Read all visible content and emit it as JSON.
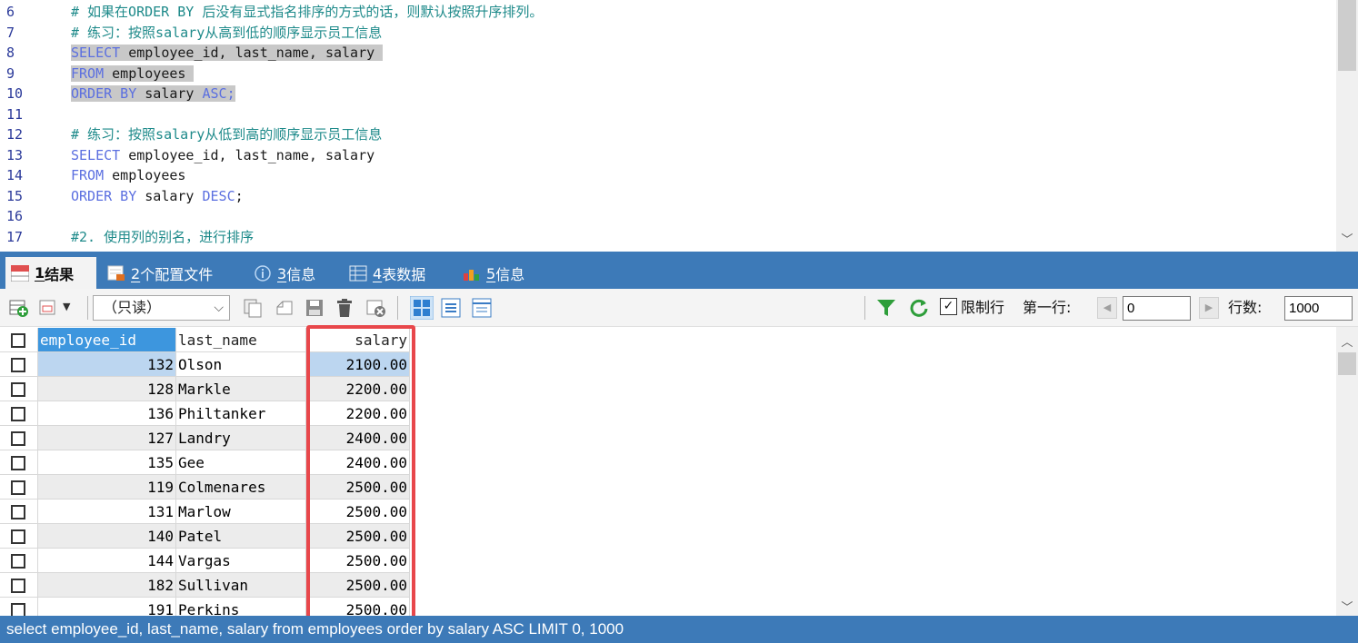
{
  "editor": {
    "lines": [
      {
        "num": "6",
        "parts": [
          {
            "t": "# 如果在ORDER BY 后没有显式指名排序的方式的话，则默认按照升序排列。",
            "c": "cm"
          }
        ],
        "hl": false
      },
      {
        "num": "7",
        "parts": [
          {
            "t": "# 练习：按照salary从高到低的顺序显示员工信息",
            "c": "cm"
          }
        ],
        "hl": false
      },
      {
        "num": "8",
        "parts": [
          {
            "t": "SELECT",
            "c": "kw"
          },
          {
            "t": " employee_id, last_name, salary ",
            "c": "id"
          }
        ],
        "hl": true
      },
      {
        "num": "9",
        "parts": [
          {
            "t": "FROM",
            "c": "kw"
          },
          {
            "t": " employees ",
            "c": "id"
          }
        ],
        "hl": true
      },
      {
        "num": "10",
        "parts": [
          {
            "t": "ORDER BY",
            "c": "kw"
          },
          {
            "t": " salary ",
            "c": "id"
          },
          {
            "t": "ASC;",
            "c": "kw"
          }
        ],
        "hl": true
      },
      {
        "num": "11",
        "parts": [],
        "hl": false
      },
      {
        "num": "12",
        "parts": [
          {
            "t": "# 练习：按照salary从低到高的顺序显示员工信息",
            "c": "cm"
          }
        ],
        "hl": false
      },
      {
        "num": "13",
        "parts": [
          {
            "t": "SELECT",
            "c": "kw"
          },
          {
            "t": " employee_id, last_name, salary",
            "c": "id"
          }
        ],
        "hl": false
      },
      {
        "num": "14",
        "parts": [
          {
            "t": "FROM",
            "c": "kw"
          },
          {
            "t": " employees",
            "c": "id"
          }
        ],
        "hl": false
      },
      {
        "num": "15",
        "parts": [
          {
            "t": "ORDER BY",
            "c": "kw"
          },
          {
            "t": " salary ",
            "c": "id"
          },
          {
            "t": "DESC",
            "c": "kw"
          },
          {
            "t": ";",
            "c": "id"
          }
        ],
        "hl": false
      },
      {
        "num": "16",
        "parts": [],
        "hl": false
      },
      {
        "num": "17",
        "parts": [
          {
            "t": "#2. 使用列的别名，进行排序",
            "c": "cm"
          }
        ],
        "hl": false
      }
    ]
  },
  "tabs": [
    {
      "num": "1",
      "label": " 结果",
      "icon": "result-grid-icon",
      "active": true
    },
    {
      "num": "2",
      "label": " 个配置文件",
      "icon": "profile-icon",
      "active": false
    },
    {
      "num": "3",
      "label": " 信息",
      "icon": "info-icon",
      "active": false
    },
    {
      "num": "4",
      "label": " 表数据",
      "icon": "table-data-icon",
      "active": false
    },
    {
      "num": "5",
      "label": " 信息",
      "icon": "info-chart-icon",
      "active": false
    }
  ],
  "toolbar": {
    "mode": "（只读）",
    "limit_rows_label": "限制行",
    "limit_rows_checked": true,
    "first_row_label": "第一行:",
    "first_row_value": "0",
    "row_count_label": "行数:",
    "row_count_value": "1000"
  },
  "grid": {
    "columns": [
      "employee_id",
      "last_name",
      "salary"
    ],
    "rows": [
      [
        "132",
        "Olson",
        "2100.00"
      ],
      [
        "128",
        "Markle",
        "2200.00"
      ],
      [
        "136",
        "Philtanker",
        "2200.00"
      ],
      [
        "127",
        "Landry",
        "2400.00"
      ],
      [
        "135",
        "Gee",
        "2400.00"
      ],
      [
        "119",
        "Colmenares",
        "2500.00"
      ],
      [
        "131",
        "Marlow",
        "2500.00"
      ],
      [
        "140",
        "Patel",
        "2500.00"
      ],
      [
        "144",
        "Vargas",
        "2500.00"
      ],
      [
        "182",
        "Sullivan",
        "2500.00"
      ],
      [
        "191",
        "Perkins",
        "2500.00"
      ]
    ],
    "selected_row": 0
  },
  "status": {
    "query": "select employee_id, last_name, salary from employees order by salary ASC LIMIT 0, 1000"
  },
  "colors": {
    "accent_blue": "#3d7ab8",
    "highlight_red": "#e8474b"
  }
}
